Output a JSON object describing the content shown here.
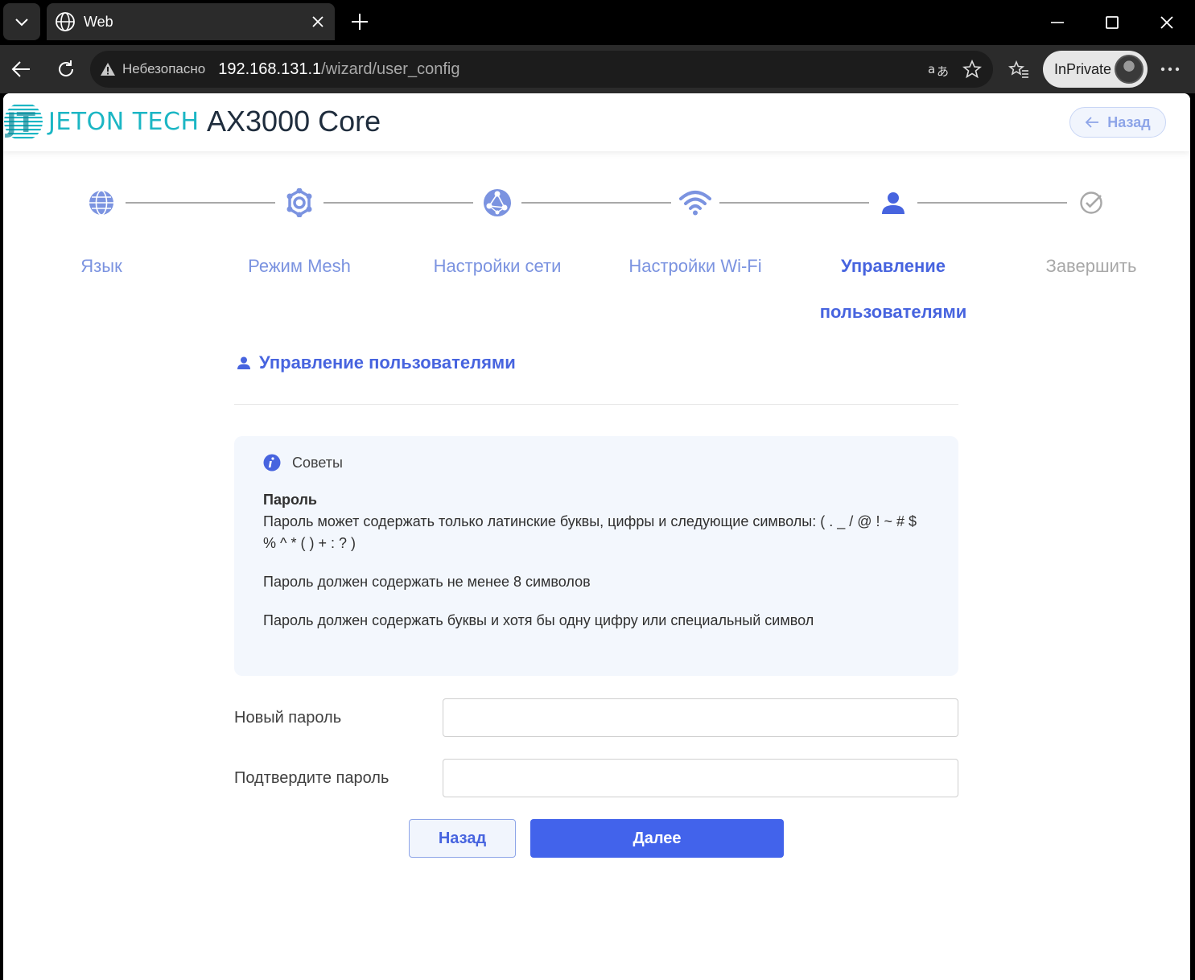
{
  "browser": {
    "tab_title": "Web",
    "security_label": "Небезопасно",
    "url_host": "192.168.131.1",
    "url_path": "/wizard/user_config",
    "inprivate_label": "InPrivate"
  },
  "header": {
    "brand": "JETON TECH",
    "product": "AX3000 Core",
    "back_label": "Назад"
  },
  "steps": [
    {
      "label": "Язык",
      "icon": "globe-icon",
      "state": "visited"
    },
    {
      "label": "Режим Mesh",
      "icon": "mesh-icon",
      "state": "visited"
    },
    {
      "label": "Настройки сети",
      "icon": "network-icon",
      "state": "visited"
    },
    {
      "label": "Настройки Wi-Fi",
      "icon": "wifi-icon",
      "state": "visited"
    },
    {
      "label": "Управление пользователями",
      "icon": "user-icon",
      "state": "active"
    },
    {
      "label": "Завершить",
      "icon": "check-circle-icon",
      "state": "pending"
    }
  ],
  "section": {
    "title": "Управление пользователями"
  },
  "tips": {
    "title": "Советы",
    "heading": "Пароль",
    "line1": "Пароль может содержать только латинские буквы, цифры и следующие символы: ( . _ / @ ! ~ # $ % ^ * ( ) + : ? )",
    "line2": "Пароль должен содержать не менее 8 символов",
    "line3": "Пароль должен содержать буквы и хотя бы одну цифру или специальный символ"
  },
  "form": {
    "new_password_label": "Новый пароль",
    "new_password_value": "",
    "confirm_password_label": "Подтвердите пароль",
    "confirm_password_value": ""
  },
  "buttons": {
    "back": "Назад",
    "next": "Далее"
  },
  "colors": {
    "accent": "#4764df",
    "primary_button": "#4263eb",
    "brand": "#1bb6c4",
    "tips_bg": "#f3f7fd"
  }
}
